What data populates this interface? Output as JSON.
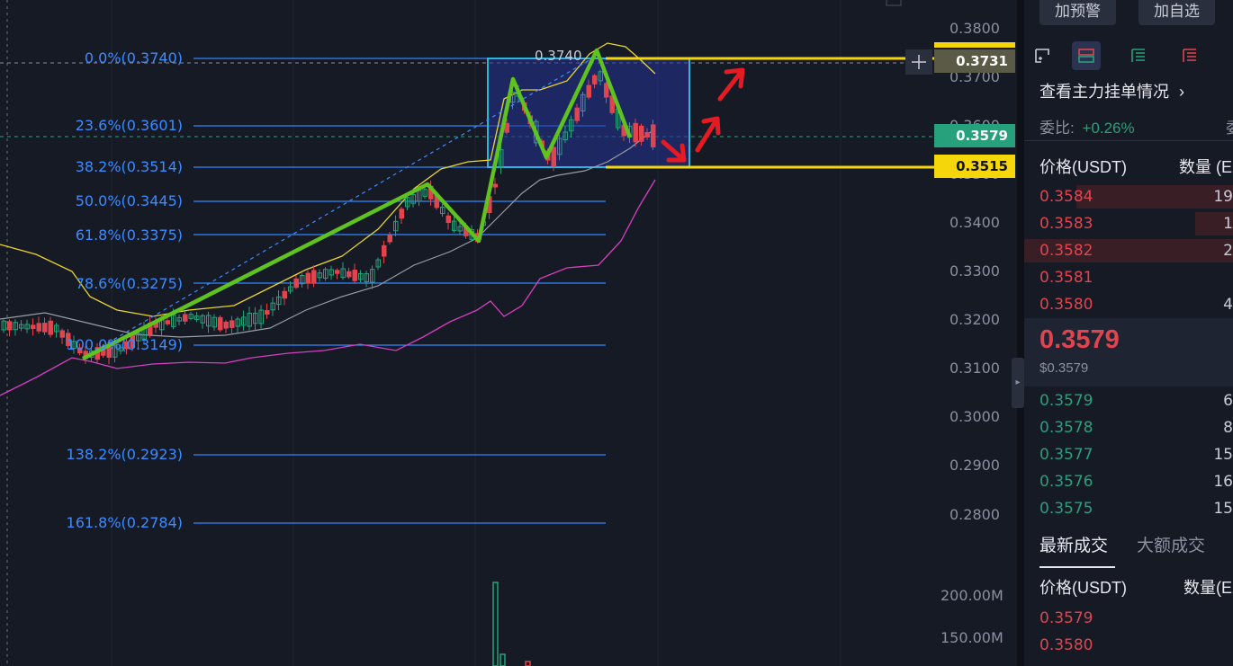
{
  "chart": {
    "price_axis": [
      "0.3800",
      "0.3700",
      "0.3600",
      "0.3500",
      "0.3400",
      "0.3300",
      "0.3200",
      "0.3100",
      "0.3000",
      "0.2900",
      "0.2800"
    ],
    "volume_axis": [
      "200.00M",
      "150.00M"
    ],
    "fib_levels": [
      {
        "label": "0.0%(0.3740)"
      },
      {
        "label": "23.6%(0.3601)"
      },
      {
        "label": "38.2%(0.3514)"
      },
      {
        "label": "50.0%(0.3445)"
      },
      {
        "label": "61.8%(0.3375)"
      },
      {
        "label": "78.6%(0.3275)"
      },
      {
        "label": "100.0%(0.3149)"
      },
      {
        "label": "138.2%(0.2923)"
      },
      {
        "label": "161.8%(0.2784)"
      }
    ],
    "high_marker": "0.3740",
    "crosshair_price": "0.3731",
    "current_price_tag": "0.3579",
    "support_tag": "0.3515",
    "crosshair_plus": "+",
    "colors": {
      "fib": "#3d8bff",
      "pattern": "#5fc21f",
      "support": "#f5d60a",
      "up": "#26a17b",
      "down": "#e0444f",
      "arrow": "#e51b23",
      "box": "#2d3a9a"
    }
  },
  "panel": {
    "buttons": {
      "alert": "加预警",
      "watchlist": "加自选"
    },
    "icons": [
      "layout-icon",
      "orderbook-both-icon",
      "orderbook-bids-icon",
      "orderbook-asks-icon"
    ],
    "main_orders": "查看主力挂单情况",
    "ratio_label": "委比:",
    "ratio_value": "+0.26%",
    "ratio_cut": "委",
    "header_price": "价格(USDT)",
    "header_qty": "数量 (E",
    "asks": [
      {
        "price": "0.3584",
        "qty": "19",
        "depth": 0.85
      },
      {
        "price": "0.3583",
        "qty": "1",
        "depth": 0.18
      },
      {
        "price": "0.3582",
        "qty": "2",
        "depth": 1.0
      },
      {
        "price": "0.3581",
        "qty": "",
        "depth": 0.0
      },
      {
        "price": "0.3580",
        "qty": "4",
        "depth": 0.0
      }
    ],
    "last_price": "0.3579",
    "last_price_usd": "$0.3579",
    "bids": [
      {
        "price": "0.3579",
        "qty": "6"
      },
      {
        "price": "0.3578",
        "qty": "8"
      },
      {
        "price": "0.3577",
        "qty": "15"
      },
      {
        "price": "0.3576",
        "qty": "16"
      },
      {
        "price": "0.3575",
        "qty": "15"
      }
    ],
    "tabs": [
      "最新成交",
      "大额成交"
    ],
    "trades_header_price": "价格(USDT)",
    "trades_header_qty": "数量(E",
    "trades": [
      "0.3579",
      "0.3580"
    ]
  }
}
